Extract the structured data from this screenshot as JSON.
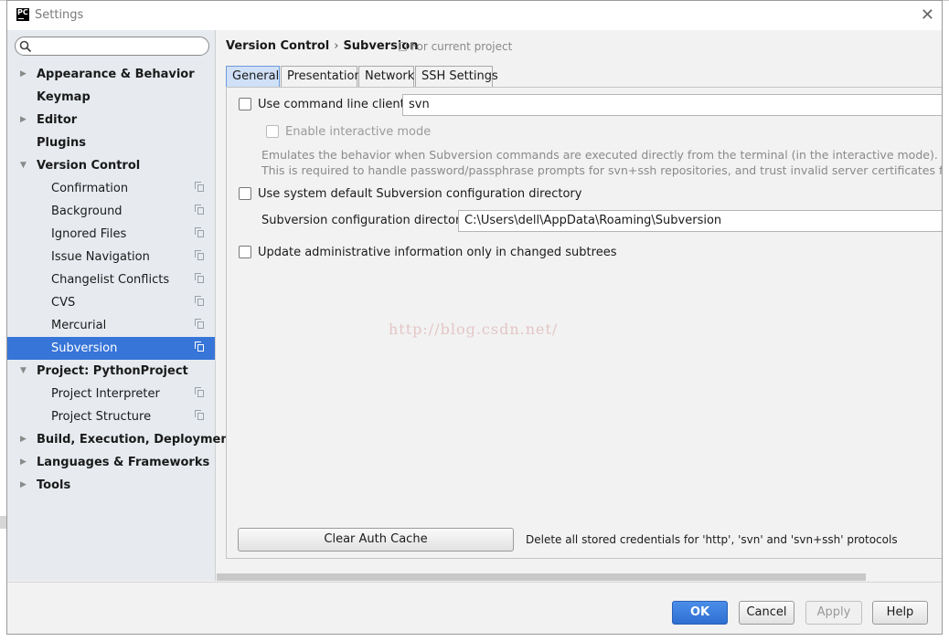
{
  "window": {
    "title": "Settings",
    "logo_text": "PC"
  },
  "sidebar": {
    "search_placeholder": "",
    "items": [
      {
        "label": "Appearance & Behavior",
        "level": 0,
        "bold": true,
        "expander": "collapsed"
      },
      {
        "label": "Keymap",
        "level": 0,
        "bold": true,
        "expander": "none"
      },
      {
        "label": "Editor",
        "level": 0,
        "bold": true,
        "expander": "collapsed"
      },
      {
        "label": "Plugins",
        "level": 0,
        "bold": true,
        "expander": "none"
      },
      {
        "label": "Version Control",
        "level": 0,
        "bold": true,
        "expander": "expanded"
      },
      {
        "label": "Confirmation",
        "level": 1,
        "bold": false,
        "project_icon": true
      },
      {
        "label": "Background",
        "level": 1,
        "bold": false,
        "project_icon": true
      },
      {
        "label": "Ignored Files",
        "level": 1,
        "bold": false,
        "project_icon": true
      },
      {
        "label": "Issue Navigation",
        "level": 1,
        "bold": false,
        "project_icon": true
      },
      {
        "label": "Changelist Conflicts",
        "level": 1,
        "bold": false,
        "project_icon": true
      },
      {
        "label": "CVS",
        "level": 1,
        "bold": false,
        "project_icon": true
      },
      {
        "label": "Mercurial",
        "level": 1,
        "bold": false,
        "project_icon": true
      },
      {
        "label": "Subversion",
        "level": 1,
        "bold": false,
        "project_icon": true,
        "selected": true
      },
      {
        "label": "Project: PythonProject",
        "level": 0,
        "bold": true,
        "expander": "expanded"
      },
      {
        "label": "Project Interpreter",
        "level": 1,
        "bold": false,
        "project_icon": true
      },
      {
        "label": "Project Structure",
        "level": 1,
        "bold": false,
        "project_icon": true
      },
      {
        "label": "Build, Execution, Deployment",
        "level": 0,
        "bold": true,
        "expander": "collapsed"
      },
      {
        "label": "Languages & Frameworks",
        "level": 0,
        "bold": true,
        "expander": "collapsed"
      },
      {
        "label": "Tools",
        "level": 0,
        "bold": true,
        "expander": "collapsed"
      }
    ]
  },
  "breadcrumb": {
    "parent": "Version Control",
    "separator": "›",
    "current": "Subversion",
    "note": "For current project"
  },
  "tabs": [
    "General",
    "Presentation",
    "Network",
    "SSH Settings"
  ],
  "active_tab": "General",
  "general": {
    "use_cmd_label": "Use command line client:",
    "use_cmd_checked": false,
    "cmd_value": "svn",
    "interactive_label": "Enable interactive mode",
    "desc_line1": "Emulates the behavior when Subversion commands are executed directly from the terminal (in the interactive mode).",
    "desc_line2": "This is required to handle password/passphrase prompts for svn+ssh repositories, and trust invalid server certificates for https",
    "use_default_label": "Use system default Subversion configuration directory",
    "config_dir_label": "Subversion configuration directory:",
    "config_dir_value": "C:\\Users\\dell\\AppData\\Roaming\\Subversion",
    "update_admin_label": "Update administrative information only in changed subtrees",
    "clear_cache_label": "Clear Auth Cache",
    "clear_cache_desc": "Delete all stored credentials for 'http', 'svn' and 'svn+ssh' protocols"
  },
  "watermark": "http://blog.csdn.net/",
  "footer": {
    "ok": "OK",
    "cancel": "Cancel",
    "apply": "Apply",
    "help": "Help"
  },
  "colors": {
    "selection": "#3775d8",
    "primary_button": "#3b7fe0",
    "sidebar_bg": "#e7ebf0"
  }
}
